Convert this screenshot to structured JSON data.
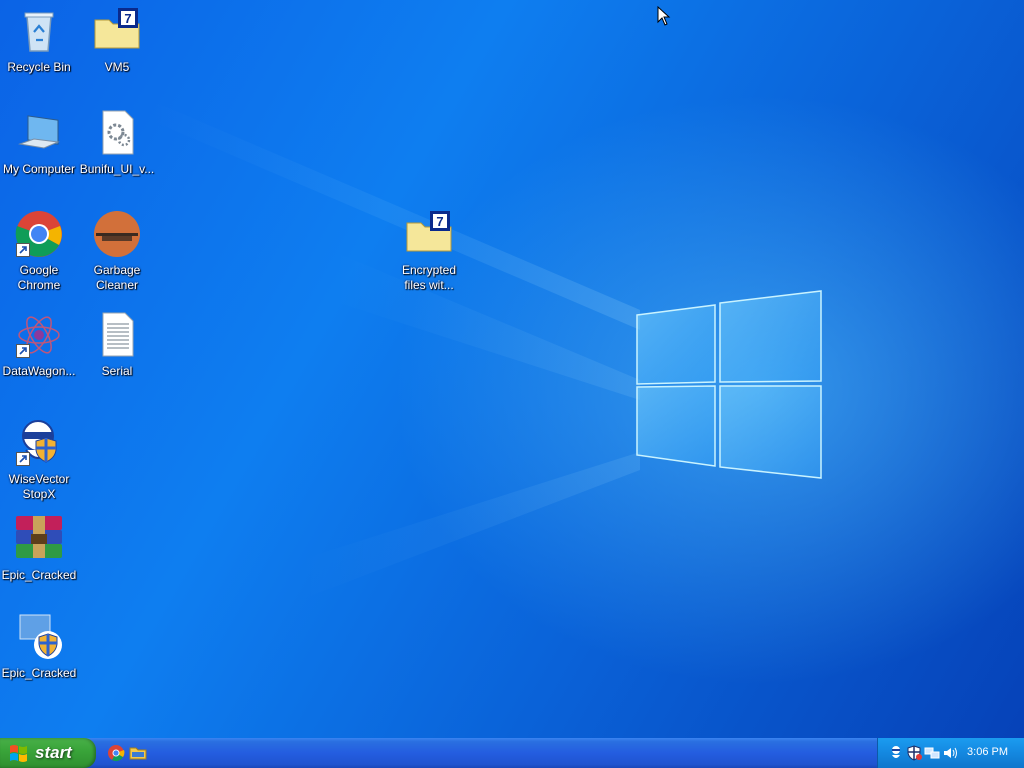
{
  "desktop": {
    "icons": [
      {
        "label": "Recycle Bin",
        "icon": "recycle-bin-icon"
      },
      {
        "label": "VM5",
        "icon": "7zip-folder-icon"
      },
      {
        "label": "My Computer",
        "icon": "computer-icon"
      },
      {
        "label": "Bunifu_UI_v...",
        "icon": "settings-file-icon"
      },
      {
        "label": "Google Chrome",
        "icon": "chrome-icon"
      },
      {
        "label": "Garbage Cleaner",
        "icon": "garbage-cleaner-icon"
      },
      {
        "label": "Encrypted files wit...",
        "icon": "7zip-folder-icon"
      },
      {
        "label": "DataWagon...",
        "icon": "datawagon-icon"
      },
      {
        "label": "Serial",
        "icon": "text-file-icon"
      },
      {
        "label": "WiseVector StopX",
        "icon": "wisevector-icon"
      },
      {
        "label": "Epic_Cracked",
        "icon": "winrar-icon"
      },
      {
        "label": "Epic_Cracked",
        "icon": "shield-installer-icon"
      }
    ]
  },
  "taskbar": {
    "start_label": "start",
    "quick_launch": [
      "chrome-icon",
      "folder-icon"
    ],
    "tray_icons": [
      "wisevector-tray-icon",
      "security-shield-icon",
      "network-icon",
      "volume-icon"
    ],
    "clock": "3:06 PM"
  },
  "colors": {
    "desktop_blue": "#0b63e6",
    "taskbar_blue": "#245de0",
    "start_green": "#3aa53a",
    "tray_blue": "#1488e0"
  }
}
